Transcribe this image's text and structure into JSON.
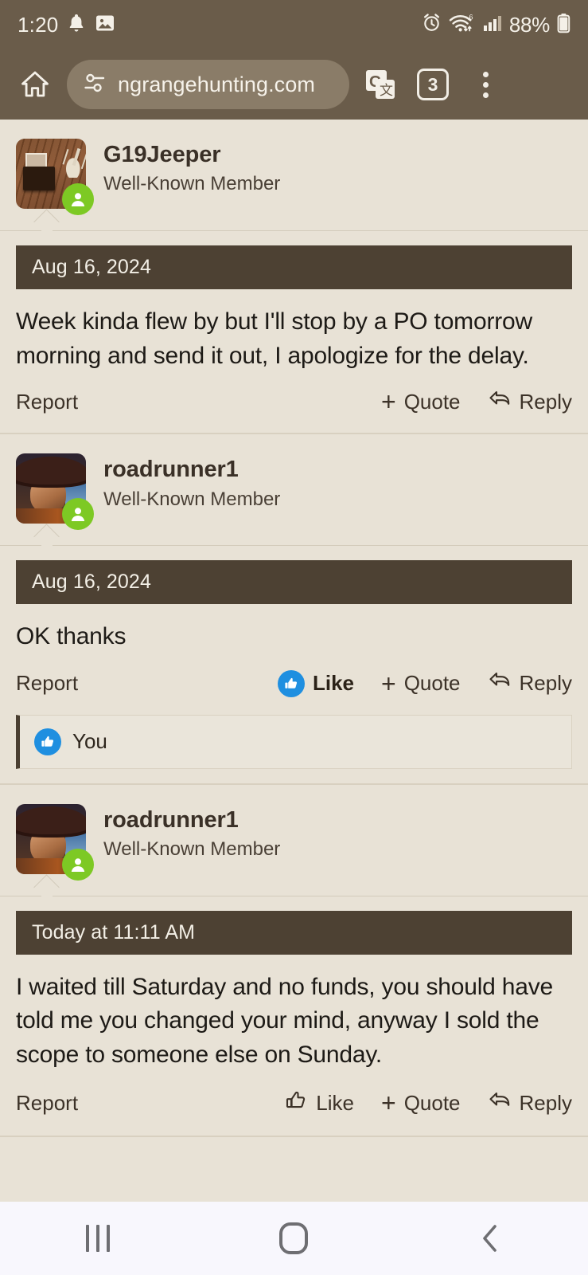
{
  "status_bar": {
    "time": "1:20",
    "battery_percent": "88%",
    "icons": [
      "bell-icon",
      "image-icon",
      "alarm-icon",
      "wifi-6-icon",
      "signal-bars-icon",
      "battery-icon"
    ]
  },
  "browser": {
    "home_icon": "home-icon",
    "site_settings_icon": "tune-icon",
    "url": "ngrangehunting.com",
    "translate_icon": "google-translate-icon",
    "tab_count": "3",
    "menu_icon": "kebab-menu-icon",
    "colors": {
      "chrome_bg": "#6A5C4A",
      "urlbar_bg": "#8A7C68"
    }
  },
  "theme": {
    "page_bg": "#E8E2D6",
    "date_bar_bg": "#4D4133",
    "accent_like": "#1F8FE0",
    "online_green": "#7DC924"
  },
  "posts": [
    {
      "username": "G19Jeeper",
      "user_title": "Well-Known Member",
      "avatar": "cabin-interior-avatar",
      "online": true,
      "date": "Aug 16, 2024",
      "body": "Week kinda flew by but I'll stop by a PO tomorrow morning and send it out, I apologize for the delay.",
      "actions": {
        "report": "Report",
        "like": null,
        "quote": "Quote",
        "reply": "Reply"
      },
      "liked": false,
      "reactions": null
    },
    {
      "username": "roadrunner1",
      "user_title": "Well-Known Member",
      "avatar": "cowboy-portrait-avatar",
      "online": true,
      "date": "Aug 16, 2024",
      "body": "OK thanks",
      "actions": {
        "report": "Report",
        "like": "Like",
        "quote": "Quote",
        "reply": "Reply"
      },
      "liked": true,
      "reactions": {
        "label": "You",
        "icon": "thumbs-up-filled-icon"
      }
    },
    {
      "username": "roadrunner1",
      "user_title": "Well-Known Member",
      "avatar": "cowboy-portrait-avatar",
      "online": true,
      "date": "Today at 11:11 AM",
      "body": "I waited till Saturday and no funds, you should have told me you changed your mind, anyway I sold the scope to someone else on Sunday.",
      "actions": {
        "report": "Report",
        "like": "Like",
        "quote": "Quote",
        "reply": "Reply"
      },
      "liked": false,
      "reactions": null
    }
  ],
  "nav_bar": {
    "recents_icon": "recents-icon",
    "home_icon": "home-circle-icon",
    "back_icon": "back-chevron-icon"
  }
}
